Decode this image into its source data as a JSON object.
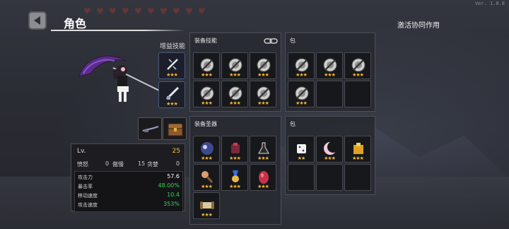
{
  "window": {
    "version": "Ver. 1.0.8"
  },
  "header": {
    "title": "角色",
    "synergy_label": "激活协同作用"
  },
  "buffs": {
    "label": "增益技能",
    "slots": [
      {
        "icon": "sword-slash-icon",
        "stars": "★★★"
      },
      {
        "icon": "sword-strike-icon",
        "stars": "★★★"
      }
    ]
  },
  "character": {
    "name_icon": "scythe-maid-character"
  },
  "weapons": [
    {
      "icon": "rifle-icon"
    },
    {
      "icon": "treasure-chest-icon"
    }
  ],
  "stats": {
    "lv_label": "Lv.",
    "lv_value": "25",
    "rage_label": "愤怒",
    "rage_value": "0",
    "pride_label": "傲慢",
    "pride_value": "15",
    "greed_label": "贪婪",
    "greed_value": "0",
    "rows": [
      {
        "label": "攻击力",
        "value": "57.6",
        "color": "#ffffff"
      },
      {
        "label": "暴击率",
        "value": "48.00%",
        "color": "#39d353"
      },
      {
        "label": "移动速度",
        "value": "10.4",
        "color": "#39d353"
      },
      {
        "label": "攻击速度",
        "value": "353%",
        "color": "#39d353"
      }
    ]
  },
  "equip_skills": {
    "title": "装备技能",
    "slots": [
      {
        "icon": "locked-skill-icon",
        "stars": "★★★"
      },
      {
        "icon": "locked-skill-icon",
        "stars": "★★★"
      },
      {
        "icon": "locked-skill-icon",
        "stars": "★★★"
      },
      {
        "icon": "locked-skill-icon",
        "stars": "★★★"
      },
      {
        "icon": "locked-skill-icon",
        "stars": "★★★"
      },
      {
        "icon": "locked-skill-icon",
        "stars": "★★★"
      }
    ]
  },
  "bag_top": {
    "title": "包",
    "slots": [
      {
        "icon": "locked-skill-icon",
        "stars": "★★★"
      },
      {
        "icon": "locked-skill-icon",
        "stars": "★★★"
      },
      {
        "icon": "locked-skill-icon",
        "stars": "★★★"
      },
      {
        "icon": "locked-skill-icon",
        "stars": "★★★"
      },
      {
        "icon": "",
        "stars": ""
      },
      {
        "icon": "",
        "stars": ""
      }
    ]
  },
  "equip_relics": {
    "title": "装备圣器",
    "slots": [
      {
        "icon": "moon-orb-icon",
        "stars": "★★★"
      },
      {
        "icon": "armor-relic-icon",
        "stars": "★★★"
      },
      {
        "icon": "flask-relic-icon",
        "stars": "★★★"
      },
      {
        "icon": "microphone-relic-icon",
        "stars": "★★★"
      },
      {
        "icon": "medal-relic-icon",
        "stars": "★★★"
      },
      {
        "icon": "egg-relic-icon",
        "stars": "★★★"
      },
      {
        "icon": "scroll-relic-icon",
        "stars": "★★★"
      }
    ]
  },
  "bag_bottom": {
    "title": "包",
    "slots": [
      {
        "icon": "dice-relic-icon",
        "stars": "★★"
      },
      {
        "icon": "crescent-relic-icon",
        "stars": "★★★"
      },
      {
        "icon": "box-relic-icon",
        "stars": "★★★"
      },
      {
        "icon": "",
        "stars": ""
      },
      {
        "icon": "",
        "stars": ""
      },
      {
        "icon": "",
        "stars": ""
      }
    ]
  },
  "colors": {
    "star": "#f2b632",
    "panel": "#2a2c34",
    "buff_border": "#4b5a7a"
  }
}
